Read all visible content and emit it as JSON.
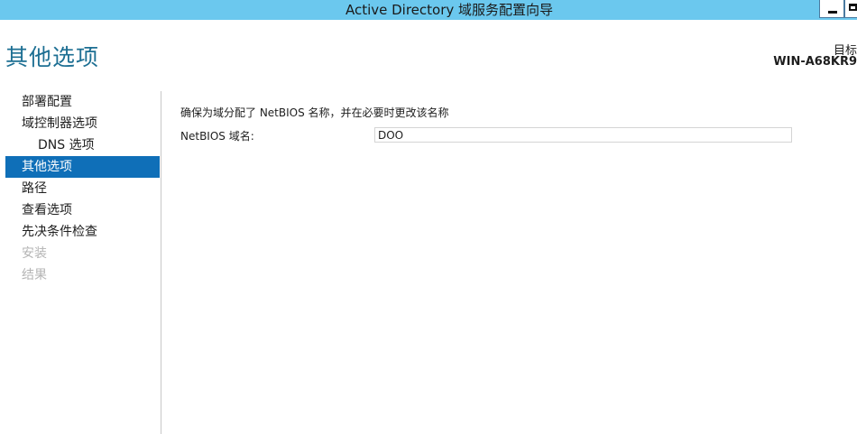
{
  "window": {
    "title": "Active Directory 域服务配置向导"
  },
  "header": {
    "page_title": "其他选项",
    "target_label": "目标",
    "target_server": "WIN-A68KR9"
  },
  "sidebar": {
    "items": [
      {
        "label": "部署配置",
        "state": "normal"
      },
      {
        "label": "域控制器选项",
        "state": "normal"
      },
      {
        "label": "DNS 选项",
        "state": "sub"
      },
      {
        "label": "其他选项",
        "state": "active"
      },
      {
        "label": "路径",
        "state": "normal"
      },
      {
        "label": "查看选项",
        "state": "normal"
      },
      {
        "label": "先决条件检查",
        "state": "normal"
      },
      {
        "label": "安装",
        "state": "disabled"
      },
      {
        "label": "结果",
        "state": "disabled"
      }
    ]
  },
  "main": {
    "description": "确保为域分配了 NetBIOS 名称，并在必要时更改该名称",
    "netbios_label": "NetBIOS 域名:",
    "netbios_value": "DOO"
  },
  "colors": {
    "titlebar": "#6bc8ee",
    "accent": "#0f6fb8",
    "page_title": "#1d6f93",
    "disabled_text": "#b4b4b4"
  }
}
